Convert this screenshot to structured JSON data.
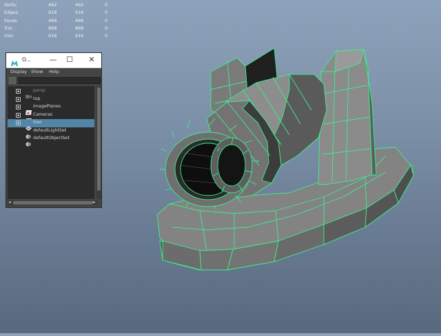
{
  "hud": {
    "rows": [
      {
        "label": "Verts:",
        "v1": "462",
        "v2": "462",
        "v3": "0"
      },
      {
        "label": "Edges:",
        "v1": "916",
        "v2": "916",
        "v3": "0"
      },
      {
        "label": "Faces:",
        "v1": "466",
        "v2": "466",
        "v3": "0"
      },
      {
        "label": "Tris:",
        "v1": "868",
        "v2": "868",
        "v3": "0"
      },
      {
        "label": "UVs:",
        "v1": "916",
        "v2": "916",
        "v3": "0"
      }
    ]
  },
  "outliner": {
    "title": "O...",
    "controls": {
      "minimize": "—",
      "maximize": "☐",
      "close": "✕"
    },
    "menu": [
      "Display",
      "Show",
      "Help"
    ],
    "items": [
      {
        "label": "persp",
        "icon": "camera-icon",
        "expandable": true,
        "dimmed": true,
        "selected": false
      },
      {
        "label": "top",
        "icon": "camera-icon",
        "expandable": true,
        "dimmed": false,
        "selected": false
      },
      {
        "label": "imagePlanes",
        "icon": "image-plane-icon",
        "expandable": true,
        "dimmed": false,
        "selected": false
      },
      {
        "label": "Cameras",
        "icon": "image-plane-icon",
        "expandable": true,
        "dimmed": false,
        "selected": false
      },
      {
        "label": "Geo",
        "icon": "group-icon",
        "expandable": true,
        "dimmed": false,
        "selected": true
      },
      {
        "label": "defaultLightSet",
        "icon": "set-icon",
        "expandable": false,
        "dimmed": false,
        "selected": false
      },
      {
        "label": "defaultObjectSet",
        "icon": "set-icon",
        "expandable": false,
        "dimmed": false,
        "selected": false
      }
    ]
  },
  "colors": {
    "wire": "#3cf08c",
    "selection": "#5285a6",
    "viewport_top": "#8ea3bb",
    "viewport_bottom": "#59697c"
  }
}
